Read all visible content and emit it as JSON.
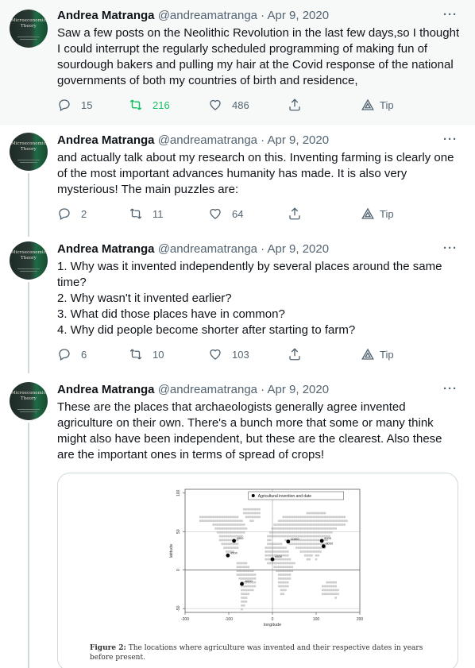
{
  "tweets": [
    {
      "author_name": "Andrea Matranga",
      "handle_date": "@andreamatranga · Apr 9, 2020",
      "text": "Saw a few posts on the Neolithic Revolution in the last few days,so I thought I could interrupt the regularly scheduled programming of making fun of sourdough bakers and pulling my hair at the Covid response of the national governments of both my countries of birth and residence,",
      "replies": "15",
      "retweets": "216",
      "likes": "486",
      "tip": "Tip"
    },
    {
      "author_name": "Andrea Matranga",
      "handle_date": "@andreamatranga · Apr 9, 2020",
      "text": "and actually talk about my research on this. Inventing farming is clearly one of the most important advances humanity has made. It is also very mysterious! The main puzzles are:",
      "replies": "2",
      "retweets": "11",
      "likes": "64",
      "tip": "Tip"
    },
    {
      "author_name": "Andrea Matranga",
      "handle_date": "@andreamatranga · Apr 9, 2020",
      "text": "1. Why was it invented independently by several places around the same time?\n2. Why wasn't it invented earlier?\n3. What did those places have in common?\n4. Why did people become shorter after starting to farm?",
      "replies": "6",
      "retweets": "10",
      "likes": "103",
      "tip": "Tip"
    },
    {
      "author_name": "Andrea Matranga",
      "handle_date": "@andreamatranga · Apr 9, 2020",
      "text": "These are the places that archaeologists generally agree invented agriculture on their own. There's a bunch more that some or many think might also have been independent, but these are the clearest. Also these are the important ones in terms of spread of crops!"
    }
  ],
  "avatar": {
    "title_line1": "Microeconomic",
    "title_line2": "Theory"
  },
  "figure": {
    "legend": "Agricultural invention and date",
    "xlabel": "longitude",
    "ylabel": "latitude",
    "xticks": [
      "-200",
      "-100",
      "0",
      "100",
      "200"
    ],
    "yticks": [
      "100",
      "50",
      "0",
      "-50"
    ],
    "caption_label": "Figure 2:",
    "caption_text": "The locations where agriculture was invented and their respective dates in years before present.",
    "points": [
      {
        "lon": -88,
        "lat": 38,
        "label": "4500"
      },
      {
        "lon": -102,
        "lat": 19,
        "label": "4500"
      },
      {
        "lon": -70,
        "lat": -18,
        "label": "-6000"
      },
      {
        "lon": 36,
        "lat": 37,
        "label": "11500"
      },
      {
        "lon": 0,
        "lat": 14,
        "label": "4500"
      },
      {
        "lon": 113,
        "lat": 38,
        "label": "9000"
      },
      {
        "lon": 117,
        "lat": 31,
        "label": "9000"
      }
    ]
  },
  "colors": {
    "retweet_active": "#17bf63",
    "muted": "#536471",
    "line": "#cfd9de"
  }
}
